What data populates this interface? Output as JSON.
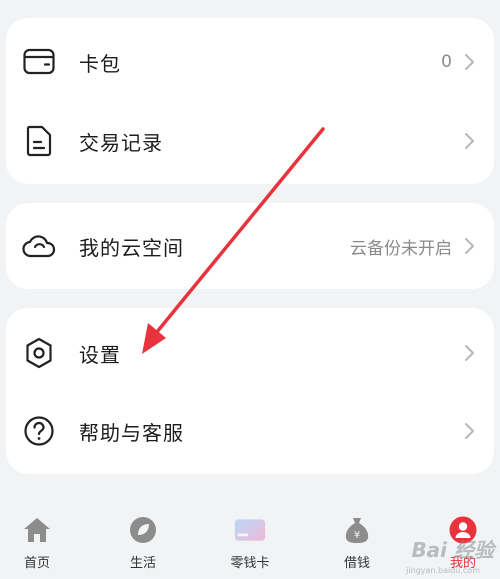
{
  "wallet_card": {
    "rows": [
      {
        "label": "卡包",
        "value": "0",
        "icon": "wallet-icon"
      },
      {
        "label": "交易记录",
        "value": "",
        "icon": "document-icon"
      }
    ]
  },
  "cloud_card": {
    "rows": [
      {
        "label": "我的云空间",
        "value": "云备份未开启",
        "icon": "cloud-icon"
      }
    ]
  },
  "settings_card": {
    "rows": [
      {
        "label": "设置",
        "value": "",
        "icon": "gear-icon"
      },
      {
        "label": "帮助与客服",
        "value": "",
        "icon": "help-icon"
      }
    ]
  },
  "tabbar": {
    "tabs": [
      {
        "label": "首页",
        "icon": "home-icon"
      },
      {
        "label": "生活",
        "icon": "life-icon"
      },
      {
        "label": "零钱卡",
        "icon": "card-icon"
      },
      {
        "label": "借钱",
        "icon": "money-bag-icon"
      },
      {
        "label": "我的",
        "icon": "profile-icon"
      }
    ],
    "active": "我的"
  },
  "watermark": {
    "text": "Bai 经验",
    "sub": "jingyan.baidu.com"
  },
  "colors": {
    "accent": "#e8333c",
    "arrow": "#e8333c",
    "background": "#f1f3f5"
  }
}
